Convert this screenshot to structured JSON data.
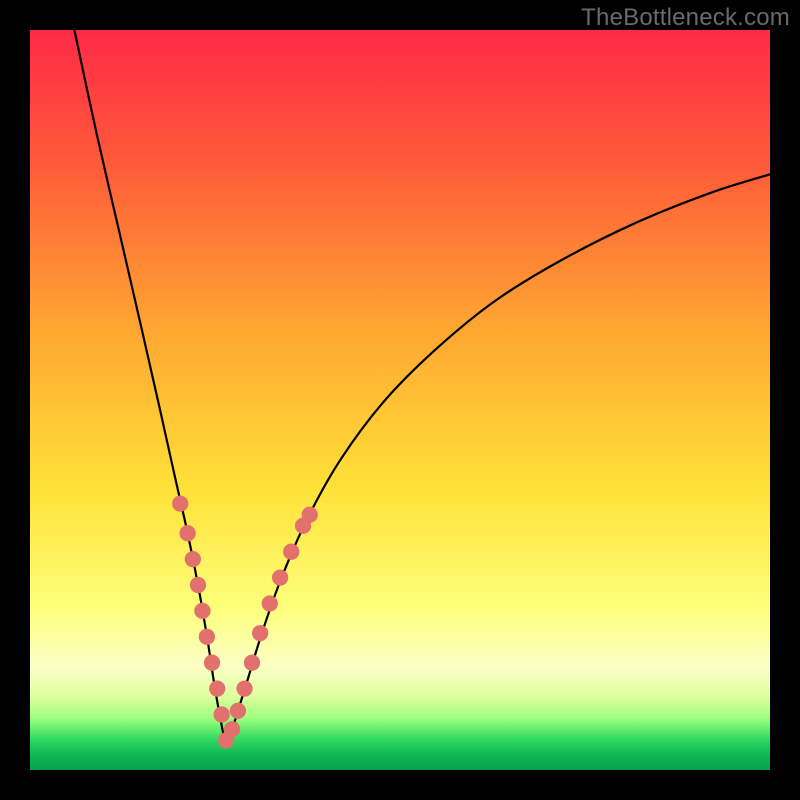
{
  "watermark": "TheBottleneck.com",
  "colors": {
    "frame": "#000000",
    "curve": "#000000",
    "marker": "#e2716d",
    "gradient_stops": [
      {
        "pct": 0,
        "color": "#ff2a46"
      },
      {
        "pct": 18,
        "color": "#ff5a3a"
      },
      {
        "pct": 40,
        "color": "#ffa531"
      },
      {
        "pct": 62,
        "color": "#ffe138"
      },
      {
        "pct": 78,
        "color": "#feff7a"
      },
      {
        "pct": 86,
        "color": "#fbffc4"
      },
      {
        "pct": 90,
        "color": "#dfffa0"
      },
      {
        "pct": 93,
        "color": "#9dff7d"
      },
      {
        "pct": 96,
        "color": "#2bd85f"
      },
      {
        "pct": 98,
        "color": "#0fb554"
      },
      {
        "pct": 100,
        "color": "#0a9f4c"
      }
    ]
  },
  "chart_data": {
    "type": "line",
    "title": "",
    "xlabel": "",
    "ylabel": "",
    "xlim": [
      0,
      100
    ],
    "ylim": [
      0,
      100
    ],
    "note": "x and y are in 0–100 plot-area coordinates; y=0 is top, y=100 is bottom of the gradient box. The visible curve is an asymmetric V: steep descent from top-left, vertex near (26.5, 97), then a slower concave rise toward upper-right. Peach markers cluster on both branches between roughly y=67 and y=97.",
    "series": [
      {
        "name": "left-branch",
        "x": [
          6.0,
          9.0,
          12.0,
          15.0,
          17.5,
          19.5,
          21.3,
          22.8,
          24.0,
          25.0,
          26.0,
          26.5
        ],
        "y": [
          0.0,
          14.0,
          27.0,
          40.0,
          51.0,
          60.0,
          68.0,
          75.5,
          82.5,
          89.0,
          94.5,
          97.0
        ]
      },
      {
        "name": "right-branch",
        "x": [
          26.5,
          27.8,
          29.5,
          31.5,
          34.0,
          37.5,
          42.0,
          48.0,
          55.0,
          63.0,
          72.0,
          82.0,
          92.0,
          100.0
        ],
        "y": [
          97.0,
          93.0,
          87.5,
          81.0,
          74.0,
          66.0,
          58.0,
          50.0,
          43.0,
          36.5,
          31.0,
          26.0,
          22.0,
          19.5
        ]
      }
    ],
    "markers": {
      "name": "highlighted-points",
      "x": [
        20.3,
        21.3,
        22.0,
        22.7,
        23.3,
        23.9,
        24.6,
        25.3,
        25.9,
        26.5,
        27.3,
        28.1,
        29.0,
        30.0,
        31.1,
        32.4,
        33.8,
        35.3,
        36.9,
        37.8
      ],
      "y": [
        64.0,
        68.0,
        71.5,
        75.0,
        78.5,
        82.0,
        85.5,
        89.0,
        92.5,
        96.0,
        94.5,
        92.0,
        89.0,
        85.5,
        81.5,
        77.5,
        74.0,
        70.5,
        67.0,
        65.5
      ],
      "r": 1.1
    }
  }
}
